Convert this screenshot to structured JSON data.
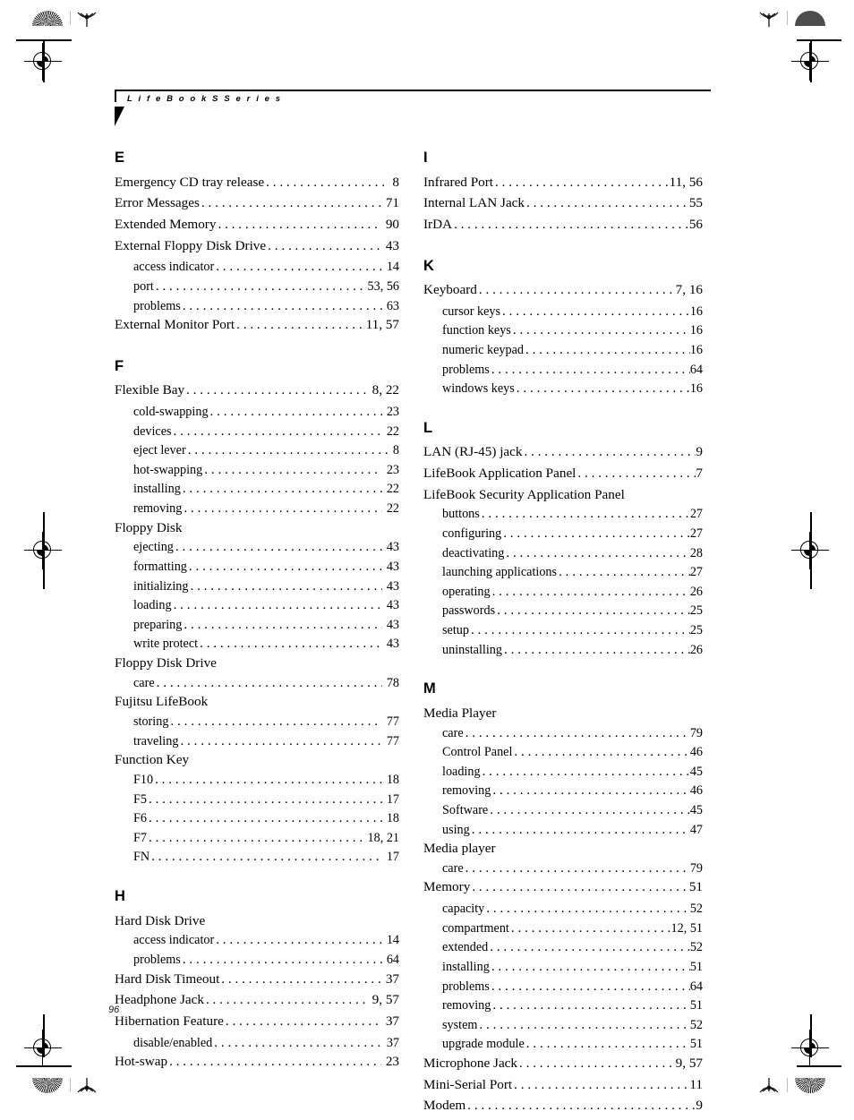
{
  "header": {
    "title": "L i f e B o o k   S   S e r i e s"
  },
  "folio": {
    "page_number": "96"
  },
  "index": {
    "left_column": [
      {
        "letter": "E",
        "entries": [
          {
            "label": "Emergency CD tray release",
            "page": "8",
            "level": "main"
          },
          {
            "label": "Error Messages",
            "page": "71",
            "level": "main"
          },
          {
            "label": "Extended Memory",
            "page": "90",
            "level": "main"
          },
          {
            "label": "External Floppy Disk Drive",
            "page": "43",
            "level": "main"
          },
          {
            "label": "access indicator",
            "page": "14",
            "level": "sub"
          },
          {
            "label": "port",
            "page": "53, 56",
            "level": "sub"
          },
          {
            "label": "problems",
            "page": "63",
            "level": "sub"
          },
          {
            "label": "External Monitor Port",
            "page": "11, 57",
            "level": "main"
          }
        ]
      },
      {
        "letter": "F",
        "entries": [
          {
            "label": "Flexible Bay",
            "page": "8, 22",
            "level": "main"
          },
          {
            "label": "cold-swapping",
            "page": "23",
            "level": "sub"
          },
          {
            "label": "devices",
            "page": "22",
            "level": "sub"
          },
          {
            "label": "eject lever",
            "page": "8",
            "level": "sub"
          },
          {
            "label": "hot-swapping",
            "page": "23",
            "level": "sub"
          },
          {
            "label": "installing",
            "page": "22",
            "level": "sub"
          },
          {
            "label": "removing",
            "page": "22",
            "level": "sub"
          },
          {
            "label": "Floppy Disk",
            "page": "",
            "level": "group"
          },
          {
            "label": "ejecting",
            "page": "43",
            "level": "sub"
          },
          {
            "label": "formatting",
            "page": "43",
            "level": "sub"
          },
          {
            "label": "initializing",
            "page": "43",
            "level": "sub"
          },
          {
            "label": "loading",
            "page": "43",
            "level": "sub"
          },
          {
            "label": "preparing",
            "page": "43",
            "level": "sub"
          },
          {
            "label": "write protect",
            "page": "43",
            "level": "sub"
          },
          {
            "label": "Floppy Disk Drive",
            "page": "",
            "level": "group"
          },
          {
            "label": "care",
            "page": "78",
            "level": "sub"
          },
          {
            "label": "Fujitsu LifeBook",
            "page": "",
            "level": "group"
          },
          {
            "label": "storing",
            "page": "77",
            "level": "sub"
          },
          {
            "label": "traveling",
            "page": "77",
            "level": "sub"
          },
          {
            "label": "Function Key",
            "page": "",
            "level": "group"
          },
          {
            "label": "F10",
            "page": "18",
            "level": "sub"
          },
          {
            "label": "F5",
            "page": "17",
            "level": "sub"
          },
          {
            "label": "F6",
            "page": "18",
            "level": "sub"
          },
          {
            "label": "F7",
            "page": "18, 21",
            "level": "sub"
          },
          {
            "label": "FN",
            "page": "17",
            "level": "sub"
          }
        ]
      },
      {
        "letter": "H",
        "entries": [
          {
            "label": "Hard Disk Drive",
            "page": "",
            "level": "group"
          },
          {
            "label": "access indicator",
            "page": "14",
            "level": "sub"
          },
          {
            "label": "problems",
            "page": "64",
            "level": "sub"
          },
          {
            "label": "Hard Disk Timeout",
            "page": "37",
            "level": "main"
          },
          {
            "label": "Headphone Jack",
            "page": "9, 57",
            "level": "main"
          },
          {
            "label": "Hibernation Feature",
            "page": "37",
            "level": "main"
          },
          {
            "label": "disable/enabled",
            "page": "37",
            "level": "sub"
          },
          {
            "label": "Hot-swap",
            "page": "23",
            "level": "main"
          }
        ]
      }
    ],
    "right_column": [
      {
        "letter": "I",
        "entries": [
          {
            "label": "Infrared Port",
            "page": "11, 56",
            "level": "main"
          },
          {
            "label": "Internal LAN Jack",
            "page": "55",
            "level": "main"
          },
          {
            "label": "IrDA",
            "page": "56",
            "level": "main"
          }
        ]
      },
      {
        "letter": "K",
        "entries": [
          {
            "label": "Keyboard",
            "page": "7, 16",
            "level": "main"
          },
          {
            "label": "cursor keys",
            "page": "16",
            "level": "sub"
          },
          {
            "label": "function keys",
            "page": "16",
            "level": "sub"
          },
          {
            "label": "numeric keypad",
            "page": "16",
            "level": "sub"
          },
          {
            "label": "problems",
            "page": "64",
            "level": "sub"
          },
          {
            "label": "windows keys",
            "page": "16",
            "level": "sub"
          }
        ]
      },
      {
        "letter": "L",
        "entries": [
          {
            "label": "LAN (RJ-45) jack",
            "page": "9",
            "level": "main"
          },
          {
            "label": "LifeBook Application Panel",
            "page": "7",
            "level": "main"
          },
          {
            "label": "LifeBook Security Application Panel",
            "page": "",
            "level": "group"
          },
          {
            "label": "buttons",
            "page": "27",
            "level": "sub"
          },
          {
            "label": "configuring",
            "page": "27",
            "level": "sub"
          },
          {
            "label": "deactivating",
            "page": "28",
            "level": "sub"
          },
          {
            "label": "launching applications",
            "page": "27",
            "level": "sub"
          },
          {
            "label": "operating",
            "page": "26",
            "level": "sub"
          },
          {
            "label": "passwords",
            "page": "25",
            "level": "sub"
          },
          {
            "label": "setup",
            "page": "25",
            "level": "sub"
          },
          {
            "label": "uninstalling",
            "page": "26",
            "level": "sub"
          }
        ]
      },
      {
        "letter": "M",
        "entries": [
          {
            "label": "Media Player",
            "page": "",
            "level": "group"
          },
          {
            "label": "care",
            "page": "79",
            "level": "sub"
          },
          {
            "label": "Control Panel",
            "page": "46",
            "level": "sub"
          },
          {
            "label": "loading",
            "page": "45",
            "level": "sub"
          },
          {
            "label": "removing",
            "page": "46",
            "level": "sub"
          },
          {
            "label": "Software",
            "page": "45",
            "level": "sub"
          },
          {
            "label": "using",
            "page": "47",
            "level": "sub"
          },
          {
            "label": "Media player",
            "page": "",
            "level": "group"
          },
          {
            "label": "care",
            "page": "79",
            "level": "sub"
          },
          {
            "label": "Memory",
            "page": "51",
            "level": "main"
          },
          {
            "label": "capacity",
            "page": "52",
            "level": "sub"
          },
          {
            "label": "compartment",
            "page": "12, 51",
            "level": "sub"
          },
          {
            "label": "extended",
            "page": "52",
            "level": "sub"
          },
          {
            "label": "installing",
            "page": "51",
            "level": "sub"
          },
          {
            "label": "problems",
            "page": "64",
            "level": "sub"
          },
          {
            "label": "removing",
            "page": "51",
            "level": "sub"
          },
          {
            "label": "system",
            "page": "52",
            "level": "sub"
          },
          {
            "label": "upgrade module",
            "page": "51",
            "level": "sub"
          },
          {
            "label": "Microphone Jack",
            "page": "9, 57",
            "level": "main"
          },
          {
            "label": "Mini-Serial Port",
            "page": "11",
            "level": "main"
          },
          {
            "label": "Modem",
            "page": "9",
            "level": "main"
          }
        ]
      }
    ]
  }
}
